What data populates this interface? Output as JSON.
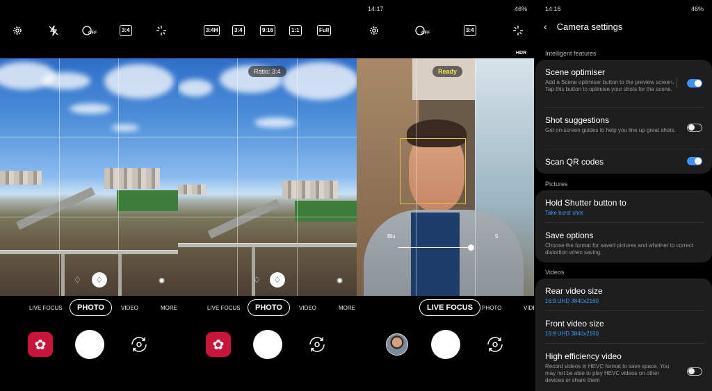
{
  "panel1": {
    "top_icons": [
      "gear-icon",
      "flash-off-icon",
      "timer-off-icon",
      "ratio-3-4",
      "effects-icon"
    ],
    "ratio_label": "3:4",
    "timer_label": "OFF",
    "modes": [
      "LIVE FOCUS",
      "PHOTO",
      "VIDEO",
      "MORE"
    ],
    "active_mode": "PHOTO"
  },
  "panel2": {
    "ratio_options": [
      "3:4H",
      "3:4",
      "9:16",
      "1:1",
      "Full"
    ],
    "ratio_pill": "Ratio: 3:4",
    "modes": [
      "LIVE FOCUS",
      "PHOTO",
      "VIDEO",
      "MORE"
    ],
    "active_mode": "PHOTO"
  },
  "panel3": {
    "status_time": "14:17",
    "battery": "46%",
    "ratio_label": "3:4",
    "timer_label": "OFF",
    "hdr_label": "HDR",
    "ready_pill": "Ready",
    "blur_min": "Blu",
    "blur_max": "5",
    "modes": [
      "LIVE FOCUS",
      "PHOTO",
      "VIDE"
    ],
    "active_mode": "LIVE FOCUS"
  },
  "settings": {
    "status_time": "14:16",
    "battery": "46%",
    "title": "Camera settings",
    "sections": {
      "intelligent": "Intelligent features",
      "pictures": "Pictures",
      "videos": "Videos"
    },
    "items": {
      "scene_optimiser": {
        "title": "Scene optimiser",
        "desc": "Add a Scene optimiser button to the preview screen. Tap this button to optimise your shots for the scene.",
        "on": true
      },
      "shot_suggestions": {
        "title": "Shot suggestions",
        "desc": "Get on-screen guides to help you line up great shots.",
        "on": false
      },
      "scan_qr": {
        "title": "Scan QR codes",
        "on": true
      },
      "hold_shutter": {
        "title": "Hold Shutter button to",
        "value": "Take burst shot"
      },
      "save_options": {
        "title": "Save options",
        "desc": "Choose the format for saved pictures and whether to correct distortion when saving."
      },
      "rear_video": {
        "title": "Rear video size",
        "value": "16:9 UHD 3840x2160"
      },
      "front_video": {
        "title": "Front video size",
        "value": "16:9 UHD 3840x2160"
      },
      "hevc": {
        "title": "High efficiency video",
        "desc": "Record videos in HEVC format to save space. You may not be able to play HEVC videos on other devices or share them",
        "on": false
      }
    }
  },
  "colors": {
    "toggle_on": "#3e91ff",
    "gallery_bg": "#c8163b",
    "link_value": "#3f9cff",
    "ready_text": "#f5e34a"
  }
}
